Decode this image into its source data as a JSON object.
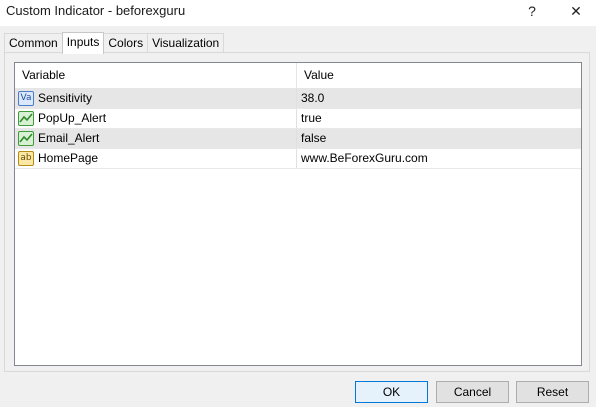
{
  "window": {
    "title": "Custom Indicator - beforexguru",
    "help_label": "?",
    "close_label": "✕"
  },
  "tabs": [
    {
      "label": "Common",
      "active": false
    },
    {
      "label": "Inputs",
      "active": true
    },
    {
      "label": "Colors",
      "active": false
    },
    {
      "label": "Visualization",
      "active": false
    }
  ],
  "grid": {
    "headers": {
      "variable": "Variable",
      "value": "Value"
    },
    "rows": [
      {
        "icon": "numeric-value-icon",
        "icon_text": "Va",
        "variable": "Sensitivity",
        "value": "38.0"
      },
      {
        "icon": "boolean-icon",
        "icon_text": "",
        "variable": "PopUp_Alert",
        "value": "true"
      },
      {
        "icon": "boolean-icon",
        "icon_text": "",
        "variable": "Email_Alert",
        "value": "false"
      },
      {
        "icon": "string-icon",
        "icon_text": "ab",
        "variable": "HomePage",
        "value": "www.BeForexGuru.com"
      }
    ]
  },
  "buttons": {
    "ok": "OK",
    "cancel": "Cancel",
    "reset": "Reset"
  }
}
